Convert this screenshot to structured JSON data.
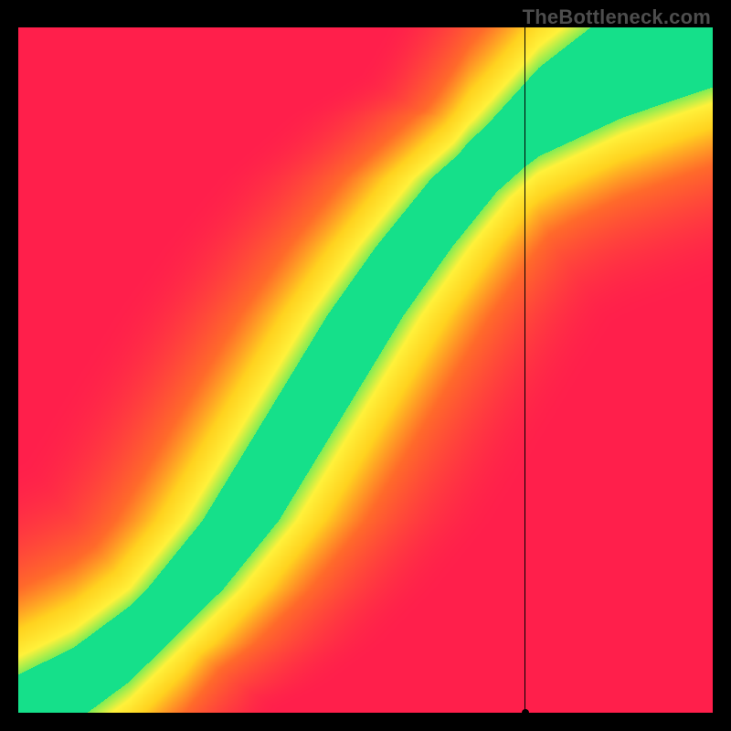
{
  "watermark": "TheBottleneck.com",
  "chart_data": {
    "type": "heatmap",
    "title": "",
    "xlabel": "",
    "ylabel": "",
    "xlim": [
      0,
      1
    ],
    "ylim": [
      0,
      1
    ],
    "marker": {
      "x": 0.73,
      "y": 0.0
    },
    "crosshair": {
      "vertical_from_top": true,
      "horizontal_full": true
    },
    "optimum_ridge": [
      {
        "x": 0.0,
        "y": 0.0
      },
      {
        "x": 0.08,
        "y": 0.04
      },
      {
        "x": 0.16,
        "y": 0.1
      },
      {
        "x": 0.24,
        "y": 0.18
      },
      {
        "x": 0.32,
        "y": 0.28
      },
      {
        "x": 0.38,
        "y": 0.38
      },
      {
        "x": 0.44,
        "y": 0.48
      },
      {
        "x": 0.5,
        "y": 0.58
      },
      {
        "x": 0.57,
        "y": 0.68
      },
      {
        "x": 0.65,
        "y": 0.78
      },
      {
        "x": 0.75,
        "y": 0.87
      },
      {
        "x": 0.87,
        "y": 0.94
      },
      {
        "x": 1.0,
        "y": 1.0
      }
    ],
    "color_stops": [
      {
        "value": 0.0,
        "color": "#ff1f4b"
      },
      {
        "value": 0.35,
        "color": "#ff6a2a"
      },
      {
        "value": 0.6,
        "color": "#ffd21f"
      },
      {
        "value": 0.8,
        "color": "#fff13a"
      },
      {
        "value": 0.95,
        "color": "#7eec54"
      },
      {
        "value": 1.0,
        "color": "#15e08a"
      }
    ],
    "ridge_half_width": 0.055,
    "ridge_half_width_taper_start": 0.7,
    "ridge_half_width_end": 0.1,
    "gradient_falloff": 0.32,
    "corner_patch": {
      "x_range": [
        0.0,
        0.03
      ],
      "y_range": [
        0.0,
        0.03
      ],
      "description": "bottom-left origin patch rendered as green/yellow diagonal"
    }
  }
}
